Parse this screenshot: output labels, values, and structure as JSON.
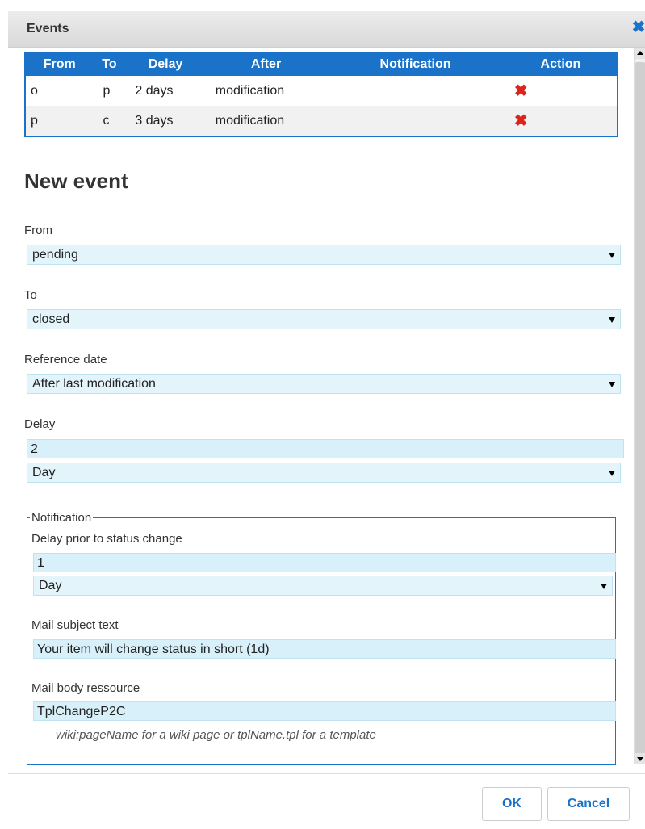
{
  "dialog": {
    "title": "Events",
    "close_icon": "close-icon"
  },
  "events_table": {
    "headers": [
      "From",
      "To",
      "Delay",
      "After",
      "Notification",
      "Action"
    ],
    "rows": [
      {
        "from": "o",
        "to": "p",
        "delay": "2 days",
        "after": "modification",
        "notification": "",
        "action": "✖"
      },
      {
        "from": "p",
        "to": "c",
        "delay": "3 days",
        "after": "modification",
        "notification": "",
        "action": "✖"
      }
    ]
  },
  "form": {
    "heading": "New event",
    "from": {
      "label": "From",
      "value": "pending"
    },
    "to": {
      "label": "To",
      "value": "closed"
    },
    "reference_date": {
      "label": "Reference date",
      "value": "After last modification"
    },
    "delay": {
      "label": "Delay",
      "value": "2",
      "unit": "Day"
    },
    "notification": {
      "legend": "Notification",
      "delay_prior": {
        "label": "Delay prior to status change",
        "value": "1",
        "unit": "Day"
      },
      "mail_subject": {
        "label": "Mail subject text",
        "value": "Your item will change status in short (1d)"
      },
      "mail_body": {
        "label": "Mail body ressource",
        "value": "TplChangeP2C",
        "hint": "wiki:pageName for a wiki page or tplName.tpl for a template"
      }
    }
  },
  "buttons": {
    "ok": "OK",
    "cancel": "Cancel"
  },
  "colors": {
    "accent": "#1a73c9",
    "delete": "#d9251c",
    "field_bg": "#e3f4fb"
  }
}
